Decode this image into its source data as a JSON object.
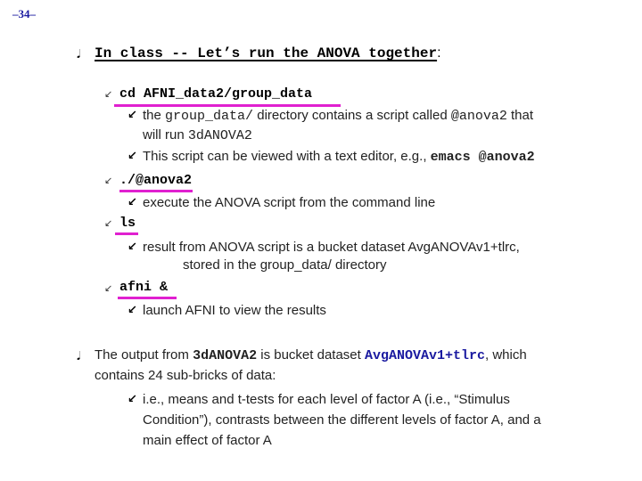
{
  "page_number": "34",
  "heading": {
    "text": "In class -- Let’s run the ANOVA together",
    "colon": ":"
  },
  "steps": [
    {
      "command": "cd AFNI_data2/group_data",
      "notes": [
        {
          "parts": [
            "the ",
            "group_data/",
            " directory contains a script called ",
            "@anova2",
            " that"
          ],
          "line2": [
            "will run ",
            "3dANOVA2"
          ]
        },
        {
          "parts": [
            "This script can be viewed with a text editor, e.g., ",
            "emacs @anova2"
          ]
        }
      ]
    },
    {
      "command": "./@anova2",
      "notes": [
        {
          "text": "execute the ANOVA script from the command line"
        }
      ]
    },
    {
      "command": "ls",
      "notes": [
        {
          "text": "result from ANOVA script is a bucket dataset AvgANOVAv1+tlrc,",
          "line2": "stored in the group_data/ directory"
        }
      ]
    },
    {
      "command": "afni &",
      "notes": [
        {
          "text": "launch AFNI to view the results"
        }
      ]
    }
  ],
  "output_point": {
    "parts": [
      "The output from ",
      "3dANOVA2",
      " is bucket dataset ",
      "AvgANOVAv1+tlrc",
      ", which"
    ],
    "line2": "contains 24 sub-bricks of data:",
    "sub": {
      "line1": "i.e., means and t-tests for each level of factor A (i.e., “Stimulus",
      "line2": "Condition”), contrasts between the different levels of factor A, and a",
      "line3": "main effect of factor A"
    }
  },
  "icons": {
    "level1_bullet": "⚐",
    "level2_bullet": "↙",
    "level3_bullet": "↙"
  },
  "colors": {
    "page_number": "#1a1aa0",
    "highlight_underline": "#e020d0",
    "dataset_name": "#1a1aa0"
  }
}
